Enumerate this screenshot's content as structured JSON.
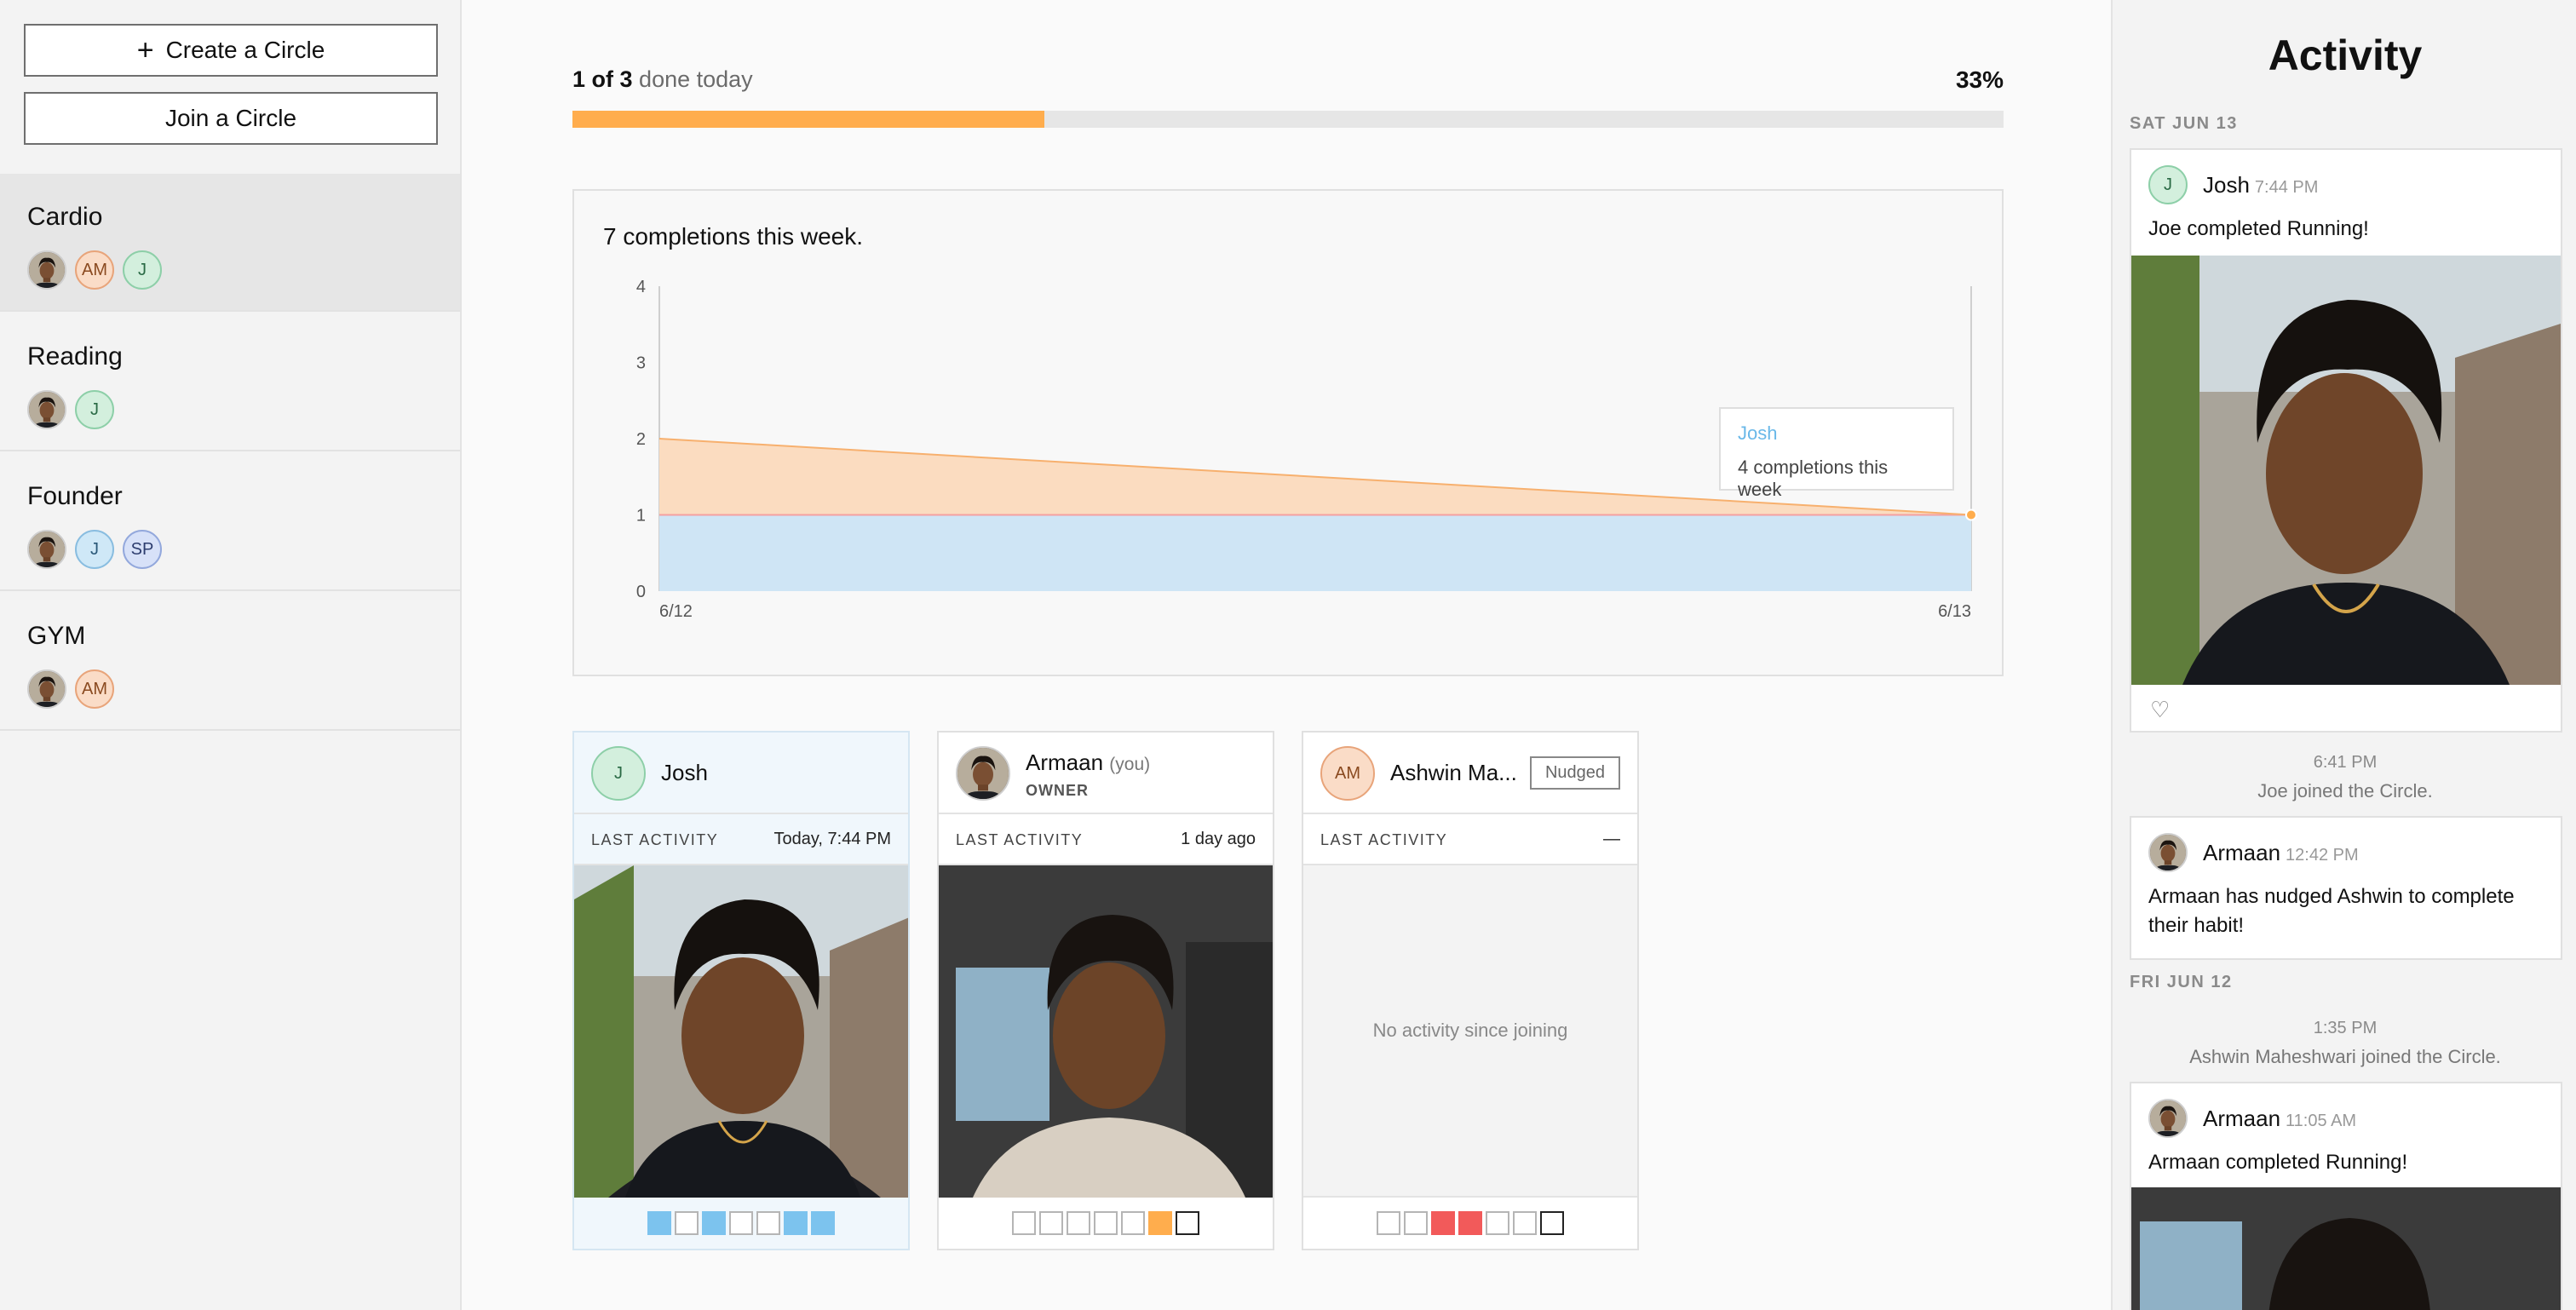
{
  "sidebar": {
    "create_label": "Create a Circle",
    "join_label": "Join a Circle",
    "circles": [
      {
        "name": "Cardio",
        "members": [
          "photo",
          "AM",
          "J"
        ]
      },
      {
        "name": "Reading",
        "members": [
          "photo",
          "J"
        ]
      },
      {
        "name": "Founder",
        "members": [
          "photo",
          "J",
          "SP"
        ]
      },
      {
        "name": "GYM",
        "members": [
          "photo",
          "AM"
        ]
      }
    ]
  },
  "progress": {
    "done": "1 of 3",
    "suffix": "done today",
    "percent_label": "33%",
    "fraction": 0.33
  },
  "chart_data": {
    "type": "area",
    "title": "7 completions this week.",
    "x": [
      "6/12",
      "6/13"
    ],
    "ylim": [
      0,
      4
    ],
    "yticks": [
      0,
      1,
      2,
      3,
      4
    ],
    "series": [
      {
        "name": "Josh",
        "values": [
          1,
          1
        ],
        "color": "#cfe5f5"
      },
      {
        "values": [
          2,
          1
        ],
        "color": "#fbdcc0"
      }
    ],
    "tooltip": {
      "name": "Josh",
      "text": "4 completions this week"
    }
  },
  "members": [
    {
      "name": "Josh",
      "initials": "J",
      "last_label": "LAST ACTIVITY",
      "last_value": "Today, 7:44 PM",
      "days": [
        "blue",
        "empty",
        "blue",
        "empty",
        "empty",
        "blue",
        "blue"
      ]
    },
    {
      "name": "Armaan",
      "you": "(you)",
      "role": "OWNER",
      "last_label": "LAST ACTIVITY",
      "last_value": "1 day ago",
      "days": [
        "empty",
        "empty",
        "empty",
        "empty",
        "empty",
        "orange",
        "today"
      ]
    },
    {
      "name": "Ashwin Ma...",
      "initials": "AM",
      "badge": "Nudged",
      "last_label": "LAST ACTIVITY",
      "last_value": "—",
      "empty_text": "No activity since joining",
      "days": [
        "empty",
        "empty",
        "red",
        "red",
        "empty",
        "empty",
        "today"
      ]
    }
  ],
  "activity": {
    "title": "Activity",
    "groups": [
      {
        "date": "SAT JUN 13"
      },
      {
        "date": "FRI JUN 12"
      }
    ],
    "posts": [
      {
        "user": "Josh",
        "initials": "J",
        "time": "7:44 PM",
        "text": "Joe completed Running!"
      },
      {
        "user": "Armaan",
        "time": "12:42 PM",
        "text": "Armaan has nudged Ashwin to complete their habit!"
      },
      {
        "user": "Armaan",
        "time": "11:05 AM",
        "text": "Armaan completed Running!"
      }
    ],
    "system": [
      {
        "time": "6:41 PM",
        "text": "Joe joined the Circle."
      },
      {
        "time": "1:35 PM",
        "text": "Ashwin Maheshwari joined the Circle."
      }
    ]
  },
  "colors": {
    "accent_orange": "#ffad4d",
    "series_blue": "#7cc3ee",
    "missed_red": "#f25a5a"
  }
}
